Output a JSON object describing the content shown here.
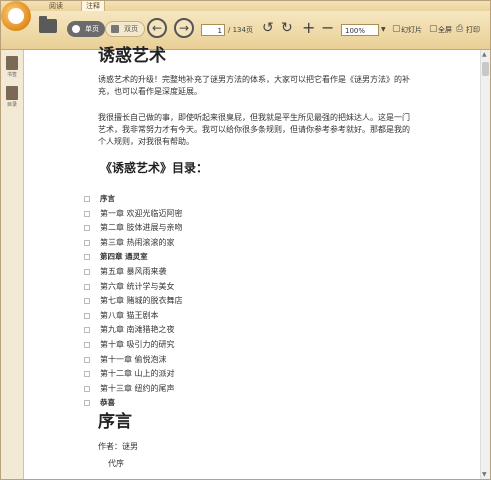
{
  "menu": {
    "tabs": [
      {
        "label": "阅读"
      },
      {
        "label": "注释"
      }
    ]
  },
  "toolbar": {
    "single_page": "单页",
    "double_page": "双页",
    "page_current": "1",
    "page_total": "/ 134页",
    "zoom": "100%",
    "slideshow": "幻灯片",
    "fullscreen": "全屏",
    "print": "打印"
  },
  "sidebar": {
    "bookmark": "书签",
    "toc": "目录"
  },
  "document": {
    "title": "诱惑艺术",
    "intro1": "诱惑艺术的升级！完整地补充了谜男方法的体系，大家可以把它看作是《谜男方法》的补充，也可以看作是深度延展。",
    "intro2": "我很擅长自己做的事，即使听起来很臭屁，但我就是平生所见最强的把妹达人。这是一门艺术，我非常努力才有今天。我可以给你很多条规则，但请你参考参考就好。那都是我的个人规则，对我很有帮助。",
    "toc_heading": "《诱惑艺术》目录：",
    "toc": [
      {
        "label": "序言",
        "bold": true
      },
      {
        "label": "第一章  欢迎光临迈阿密",
        "bold": false
      },
      {
        "label": "第二章  肢体进展与亲吻",
        "bold": false
      },
      {
        "label": "第三章  热闹滚滚的家",
        "bold": false
      },
      {
        "label": "第四章  通灵室",
        "bold": true
      },
      {
        "label": "第五章  暴风雨来袭",
        "bold": false
      },
      {
        "label": "第六章  统计学与美女",
        "bold": false
      },
      {
        "label": "第七章  赌城的脱衣舞店",
        "bold": false
      },
      {
        "label": "第八章  猫王剧本",
        "bold": false
      },
      {
        "label": "第九章  南滩猎艳之夜",
        "bold": false
      },
      {
        "label": "第十章  吸引力的研究",
        "bold": false
      },
      {
        "label": "第十一章  偷悦泡沫",
        "bold": false
      },
      {
        "label": "第十二章  山上的派对",
        "bold": false
      },
      {
        "label": "第十三章  纽约的尾声",
        "bold": false
      },
      {
        "label": "恭喜",
        "bold": true
      }
    ],
    "section_title": "序言",
    "author": "作者：谜男",
    "preface_label": "代序"
  }
}
